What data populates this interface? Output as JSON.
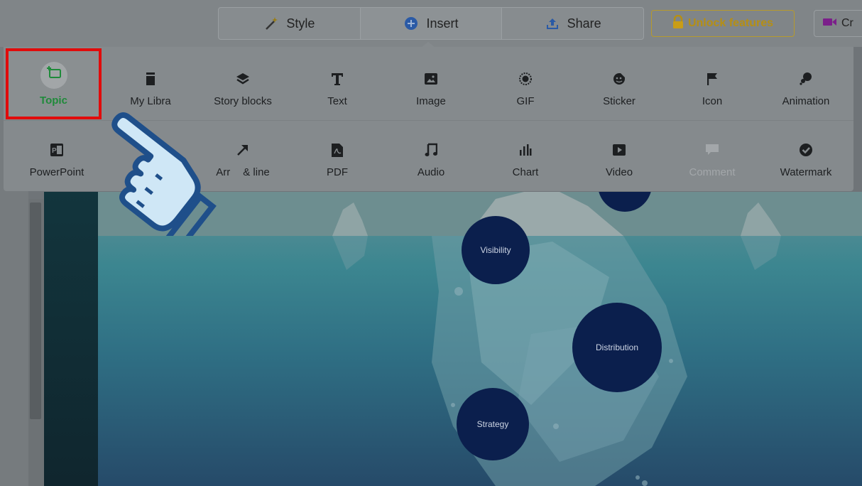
{
  "toolbar": {
    "tabs": [
      {
        "label": "Style",
        "icon": "magic-wand-icon"
      },
      {
        "label": "Insert",
        "icon": "plus-circle-icon"
      },
      {
        "label": "Share",
        "icon": "upload-icon"
      }
    ],
    "unlock_label": "Unlock features",
    "create_label": "Cr"
  },
  "insert_panel": {
    "topic_label": "Topic",
    "row1": [
      {
        "label": "My Libra",
        "icon": "library-icon"
      },
      {
        "label": "Story blocks",
        "icon": "layers-icon"
      },
      {
        "label": "Text",
        "icon": "text-icon"
      },
      {
        "label": "Image",
        "icon": "image-icon"
      },
      {
        "label": "GIF",
        "icon": "gif-icon"
      },
      {
        "label": "Sticker",
        "icon": "sticker-icon"
      },
      {
        "label": "Icon",
        "icon": "flag-icon"
      },
      {
        "label": "Animation",
        "icon": "animation-icon"
      }
    ],
    "row2": [
      {
        "label": "PowerPoint",
        "icon": "powerpoint-icon"
      },
      {
        "label": "Arr",
        "icon": "arrow-icon"
      },
      {
        "label": "& line",
        "icon": ""
      },
      {
        "label": "PDF",
        "icon": "pdf-icon"
      },
      {
        "label": "Audio",
        "icon": "music-note-icon"
      },
      {
        "label": "Chart",
        "icon": "bar-chart-icon"
      },
      {
        "label": "Video",
        "icon": "video-icon"
      },
      {
        "label": "Comment",
        "icon": "comment-icon"
      },
      {
        "label": "Watermark",
        "icon": "watermark-icon"
      }
    ]
  },
  "canvas": {
    "topics": [
      {
        "label": "Visibility"
      },
      {
        "label": "Distribution"
      },
      {
        "label": "Strategy"
      }
    ]
  },
  "colors": {
    "highlight_box": "#e10b0b",
    "topic_green": "#1f8a3a",
    "unlock_gold": "#b58f15",
    "bubble_navy": "#0b1f4d"
  }
}
